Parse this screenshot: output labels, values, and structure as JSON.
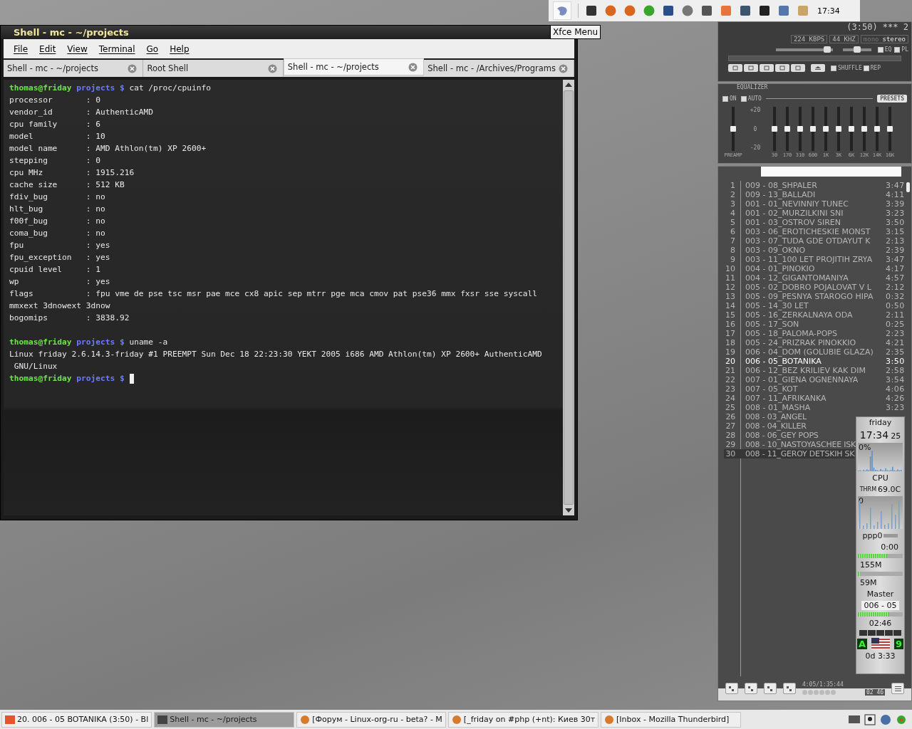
{
  "panel": {
    "clock": "17:34",
    "tooltip": "Xfce Menu"
  },
  "terminal": {
    "title": "Shell - mc - ~/projects",
    "menu": [
      "File",
      "Edit",
      "View",
      "Terminal",
      "Go",
      "Help"
    ],
    "tabs": [
      {
        "label": "Shell - mc - ~/projects",
        "selected": false
      },
      {
        "label": "Root Shell",
        "selected": false
      },
      {
        "label": "Shell - mc - ~/projects",
        "selected": true
      },
      {
        "label": "Shell - mc - /Archives/Programs",
        "selected": false
      }
    ],
    "lines": [
      {
        "kind": "prompt",
        "user": "thomas@friday",
        "dir": "projects",
        "symbol": "$",
        "command": "cat /proc/cpuinfo",
        "cursor": false
      },
      {
        "kind": "output",
        "text": "processor       : 0"
      },
      {
        "kind": "output",
        "text": "vendor_id       : AuthenticAMD"
      },
      {
        "kind": "output",
        "text": "cpu family      : 6"
      },
      {
        "kind": "output",
        "text": "model           : 10"
      },
      {
        "kind": "output",
        "text": "model name      : AMD Athlon(tm) XP 2600+"
      },
      {
        "kind": "output",
        "text": "stepping        : 0"
      },
      {
        "kind": "output",
        "text": "cpu MHz         : 1915.216"
      },
      {
        "kind": "output",
        "text": "cache size      : 512 KB"
      },
      {
        "kind": "output",
        "text": "fdiv_bug        : no"
      },
      {
        "kind": "output",
        "text": "hlt_bug         : no"
      },
      {
        "kind": "output",
        "text": "f00f_bug        : no"
      },
      {
        "kind": "output",
        "text": "coma_bug        : no"
      },
      {
        "kind": "output",
        "text": "fpu             : yes"
      },
      {
        "kind": "output",
        "text": "fpu_exception   : yes"
      },
      {
        "kind": "output",
        "text": "cpuid level     : 1"
      },
      {
        "kind": "output",
        "text": "wp              : yes"
      },
      {
        "kind": "output",
        "text": "flags           : fpu vme de pse tsc msr pae mce cx8 apic sep mtrr pge mca cmov pat pse36 mmx fxsr sse syscall"
      },
      {
        "kind": "output",
        "text": "mmxext 3dnowext 3dnow"
      },
      {
        "kind": "output",
        "text": "bogomips        : 3838.92"
      },
      {
        "kind": "blank"
      },
      {
        "kind": "prompt",
        "user": "thomas@friday",
        "dir": "projects",
        "symbol": "$",
        "command": "uname -a",
        "cursor": false
      },
      {
        "kind": "output",
        "text": "Linux friday 2.6.14.3-friday #1 PREEMPT Sun Dec 18 22:23:30 YEKT 2005 i686 AMD Athlon(tm) XP 2600+ AuthenticAMD"
      },
      {
        "kind": "output",
        "text": " GNU/Linux"
      },
      {
        "kind": "prompt",
        "user": "thomas@friday",
        "dir": "projects",
        "symbol": "$",
        "cursor": true
      }
    ]
  },
  "player": {
    "song_title": "(3:50) *** 2",
    "bitrate": "224 KBPS",
    "samplerate": "44 KHZ",
    "volume": {
      "level": 0.9
    },
    "balance": {
      "level": 0.5
    },
    "modes": [
      {
        "label": "mono",
        "selected": false
      },
      {
        "label": "stereo",
        "selected": true
      }
    ],
    "toggles": [
      {
        "label": "EQ",
        "checked": true
      },
      {
        "label": "PL",
        "checked": true
      }
    ],
    "options": [
      {
        "label": "SHUFFLE",
        "checked": true
      },
      {
        "label": "REP",
        "checked": true
      }
    ]
  },
  "equalizer": {
    "title": "EQUALIZER",
    "switches": [
      {
        "label": "ON",
        "checked": true
      },
      {
        "label": "AUTO",
        "checked": true
      }
    ],
    "presets": "PRESETS",
    "scale": [
      "+20",
      "0",
      "-20"
    ],
    "preamp": {
      "label": "PREAMP",
      "level": 0.5
    },
    "bands": [
      {
        "label": "30",
        "level": 0.5
      },
      {
        "label": "170",
        "level": 0.5
      },
      {
        "label": "310",
        "level": 0.5
      },
      {
        "label": "600",
        "level": 0.5
      },
      {
        "label": "1K",
        "level": 0.5
      },
      {
        "label": "3K",
        "level": 0.5
      },
      {
        "label": "6K",
        "level": 0.5
      },
      {
        "label": "12K",
        "level": 0.5
      },
      {
        "label": "14K",
        "level": 0.5
      },
      {
        "label": "16K",
        "level": 0.5
      }
    ]
  },
  "playlist": {
    "rows": [
      {
        "number": "1",
        "title": "009 - 08_SHPALER",
        "time": "3:47",
        "playing": false,
        "selected": false
      },
      {
        "number": "2",
        "title": "009 - 13_BALLADI",
        "time": "4:11",
        "playing": false,
        "selected": false
      },
      {
        "number": "3",
        "title": "001 - 01_NEVINNIY TUNEC",
        "time": "3:39",
        "playing": false,
        "selected": false
      },
      {
        "number": "4",
        "title": "001 - 02_MURZILKINI SNI",
        "time": "3:23",
        "playing": false,
        "selected": false
      },
      {
        "number": "5",
        "title": "001 - 03_OSTROV SIREN",
        "time": "3:50",
        "playing": false,
        "selected": false
      },
      {
        "number": "6",
        "title": "003 - 06_EROTICHESKIE MONST",
        "time": "3:15",
        "playing": false,
        "selected": false
      },
      {
        "number": "7",
        "title": "003 - 07_TUDA GDE OTDAYUT K",
        "time": "2:13",
        "playing": false,
        "selected": false
      },
      {
        "number": "8",
        "title": "003 - 09_OKNO",
        "time": "2:39",
        "playing": false,
        "selected": false
      },
      {
        "number": "9",
        "title": "003 - 11_100 LET PROJITIH ZRYA",
        "time": "3:47",
        "playing": false,
        "selected": false
      },
      {
        "number": "10",
        "title": "004 - 01_PINOKIO",
        "time": "4:17",
        "playing": false,
        "selected": false
      },
      {
        "number": "11",
        "title": "004 - 12_GIGANTOMANIYA",
        "time": "4:57",
        "playing": false,
        "selected": false
      },
      {
        "number": "12",
        "title": "005 - 02_DOBRO POJALOVAT V L",
        "time": "2:12",
        "playing": false,
        "selected": false
      },
      {
        "number": "13",
        "title": "005 - 09_PESNYA STAROGO HIPA",
        "time": "0:32",
        "playing": false,
        "selected": false
      },
      {
        "number": "14",
        "title": "005 - 14_30 LET",
        "time": "0:50",
        "playing": false,
        "selected": false
      },
      {
        "number": "15",
        "title": "005 - 16_ZERKALNAYA ODA",
        "time": "2:11",
        "playing": false,
        "selected": false
      },
      {
        "number": "16",
        "title": "005 - 17_SON",
        "time": "0:25",
        "playing": false,
        "selected": false
      },
      {
        "number": "17",
        "title": "005 - 18_PALOMA-POPS",
        "time": "2:23",
        "playing": false,
        "selected": false
      },
      {
        "number": "18",
        "title": "005 - 24_PRIZRAK PINOKKIO",
        "time": "4:21",
        "playing": false,
        "selected": false
      },
      {
        "number": "19",
        "title": "006 - 04_DOM (GOLUBIE GLAZA)",
        "time": "2:35",
        "playing": false,
        "selected": false
      },
      {
        "number": "20",
        "title": "006 - 05_BOTANIKA",
        "time": "3:50",
        "playing": true,
        "selected": false
      },
      {
        "number": "21",
        "title": "006 - 12_BEZ KRILIEV KAK DIM",
        "time": "2:58",
        "playing": false,
        "selected": false
      },
      {
        "number": "22",
        "title": "007 - 01_GIENA OGNENNAYA",
        "time": "3:54",
        "playing": false,
        "selected": false
      },
      {
        "number": "23",
        "title": "007 - 05_KOT",
        "time": "4:06",
        "playing": false,
        "selected": false
      },
      {
        "number": "24",
        "title": "007 - 11_AFRIKANKA",
        "time": "4:26",
        "playing": false,
        "selected": false
      },
      {
        "number": "25",
        "title": "008 - 01_MASHA",
        "time": "3:23",
        "playing": false,
        "selected": false
      },
      {
        "number": "26",
        "title": "008 - 03_ANGEL",
        "playing": false,
        "selected": false
      },
      {
        "number": "27",
        "title": "008 - 04_KILLER",
        "playing": false,
        "selected": false
      },
      {
        "number": "28",
        "title": "008 - 06_GEY POPS",
        "playing": false,
        "selected": false
      },
      {
        "number": "29",
        "title": "008 - 10_NASTOYASCHEE ISK",
        "playing": false,
        "selected": false
      },
      {
        "number": "30",
        "title": "008 - 11_GEROY DETSKIH SK",
        "playing": false,
        "selected": true
      }
    ],
    "total_time": "4:05/1:35:44",
    "elapsed": "02 46"
  },
  "monitor": {
    "host": "friday",
    "time": "17:34",
    "seconds": "25",
    "cpu_load": "0%",
    "cpu_label": "CPU",
    "sensor_label": "THRM",
    "temperature": "69.0C",
    "sensor_axis": "0",
    "net_label": "ppp0",
    "net_time": "0:00",
    "mem": {
      "value": "155M",
      "level": 0.65
    },
    "swap": {
      "value": "59M",
      "level": 0.06
    },
    "mixer": "Master",
    "track": "006 - 05",
    "progress": {
      "level": 0.7
    },
    "track_time": "02:46",
    "keyboard": "A",
    "desktop": "9",
    "uptime": "0d  3:33"
  },
  "taskbar": {
    "tasks": [
      {
        "label": "20. 006 - 05 BOTANIKA (3:50) - Bl",
        "selected": false
      },
      {
        "label": "Shell - mc - ~/projects",
        "selected": true
      },
      {
        "label": "[Форум - Linux-org-ru - beta? - M",
        "selected": false
      },
      {
        "label": "[_friday on #php (+nt): Киев 30т",
        "selected": false
      },
      {
        "label": "[Inbox - Mozilla Thunderbird]",
        "selected": false
      }
    ]
  }
}
